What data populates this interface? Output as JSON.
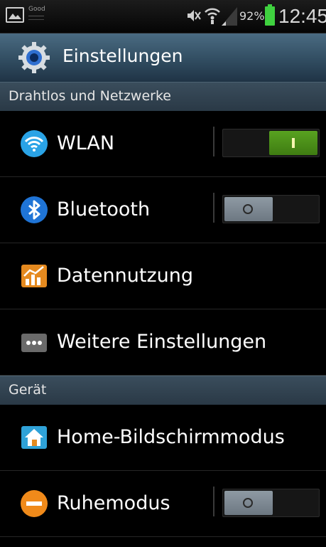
{
  "status_bar": {
    "good_label": "Good",
    "battery_percent": "92%",
    "time": "12:45",
    "icons": [
      "gallery-icon",
      "mute-icon",
      "wifi-icon",
      "signal-icon",
      "battery-icon"
    ],
    "battery_color": "#3fd13f"
  },
  "title_bar": {
    "title": "Einstellungen",
    "icon": "settings-gear-icon"
  },
  "sections": {
    "wireless": "Drahtlos und Netzwerke",
    "device": "Gerät"
  },
  "items": {
    "wlan": {
      "label": "WLAN",
      "icon": "wifi-icon",
      "toggle": "on"
    },
    "bluetooth": {
      "label": "Bluetooth",
      "icon": "bluetooth-icon",
      "toggle": "off"
    },
    "data_usage": {
      "label": "Datennutzung",
      "icon": "data-usage-icon"
    },
    "more_settings": {
      "label": "Weitere Einstellungen",
      "icon": "more-dots-icon"
    },
    "home_screen": {
      "label": "Home-Bildschirmmodus",
      "icon": "home-icon"
    },
    "blocking": {
      "label": "Ruhemodus",
      "icon": "do-not-disturb-icon",
      "toggle": "off"
    }
  },
  "colors": {
    "toggle_on": "#4f9418",
    "toggle_off": "#7c8891",
    "header_bg": "#2f4a5e"
  }
}
